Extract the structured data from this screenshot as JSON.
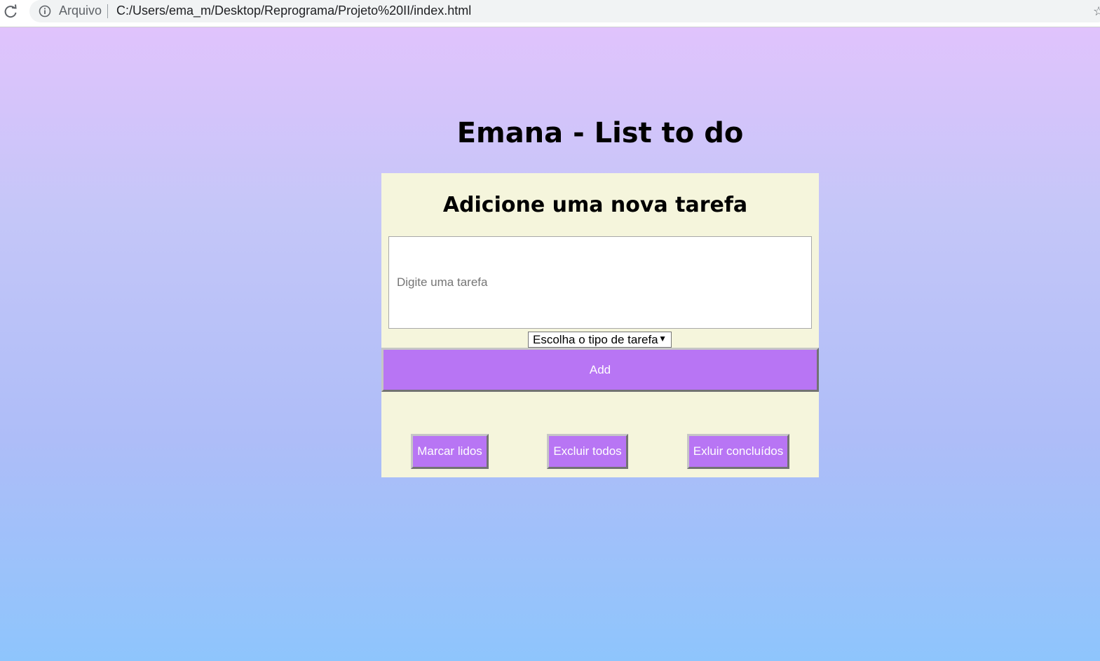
{
  "browser": {
    "reload_icon": "reload-icon",
    "info_icon": "info-icon",
    "scheme_label": "Arquivo",
    "url": "C:/Users/ema_m/Desktop/Reprograma/Projeto%20II/index.html"
  },
  "page": {
    "title": "Emana - List to do"
  },
  "card": {
    "title": "Adicione uma nova tarefa",
    "input_placeholder": "Digite uma tarefa",
    "input_value": "",
    "select_value": "Escolha o tipo de tarefa",
    "add_label": "Add",
    "actions": {
      "mark_read": "Marcar lidos",
      "delete_all": "Excluir todos",
      "delete_done": "Exluir concluídos"
    }
  },
  "colors": {
    "button_bg": "#b875f4",
    "card_bg": "#f5f5dc",
    "gradient_top": "#e0c3fc",
    "gradient_bottom": "#8ec5fc"
  }
}
